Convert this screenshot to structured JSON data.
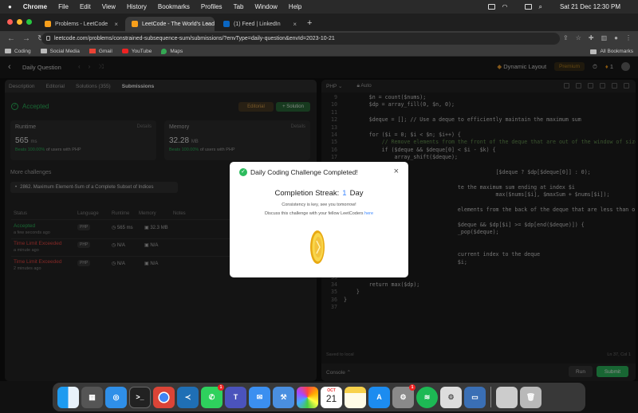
{
  "menubar": {
    "app": "Chrome",
    "items": [
      "File",
      "Edit",
      "View",
      "History",
      "Bookmarks",
      "Profiles",
      "Tab",
      "Window",
      "Help"
    ],
    "datetime": "Sat 21 Dec  12:30 PM"
  },
  "tabs": [
    {
      "title": "Problems - LeetCode",
      "active": false
    },
    {
      "title": "LeetCode - The World's Lead",
      "active": true
    },
    {
      "title": "(1) Feed | LinkedIn",
      "active": false
    }
  ],
  "address": {
    "url": "leetcode.com/problems/constrained-subsequence-sum/submissions/?envType=daily-question&envId=2023-10-21"
  },
  "bookmarks": {
    "items": [
      "Coding",
      "Social Media",
      "Gmail",
      "YouTube",
      "Maps"
    ],
    "all": "All Bookmarks"
  },
  "leetcode": {
    "section": "Daily Question",
    "layout": "Dynamic Layout",
    "premium": "Premium",
    "streak_count": "1"
  },
  "left": {
    "tabs": [
      "Description",
      "Editorial",
      "Solutions (355)",
      "Submissions"
    ],
    "status": "Accepted",
    "editorial_btn": "Editorial",
    "solution_btn": "+ Solution",
    "runtime": {
      "label": "Runtime",
      "details": "Details",
      "value": "565",
      "unit": "ms",
      "beats_pct": "Beats 100.00%",
      "beats_rest": "of users with PHP"
    },
    "memory": {
      "label": "Memory",
      "details": "Details",
      "value": "32.28",
      "unit": "MB",
      "beats_pct": "Beats 100.00%",
      "beats_rest": "of users with PHP"
    },
    "more_challenges": "More challenges",
    "challenge": "2862. Maximum Element-Sum of a Complete Subset of Indices",
    "columns": [
      "Status",
      "Language",
      "Runtime",
      "Memory",
      "Notes"
    ],
    "rows": [
      {
        "status": "Accepted",
        "time": "a few seconds ago",
        "lang": "PHP",
        "runtime": "565 ms",
        "memory": "32.3 MB"
      },
      {
        "status": "Time Limit Exceeded",
        "time": "a minute ago",
        "lang": "PHP",
        "runtime": "N/A",
        "memory": "N/A"
      },
      {
        "status": "Time Limit Exceeded",
        "time": "2 minutes ago",
        "lang": "PHP",
        "runtime": "N/A",
        "memory": "N/A"
      }
    ]
  },
  "editor": {
    "language": "PHP",
    "mode": "Auto",
    "saved": "Saved to local",
    "cursor": "Ln 37, Col 1",
    "console": "Console",
    "run": "Run",
    "submit": "Submit",
    "lines": [
      {
        "n": "9",
        "t": "        $n = count($nums);"
      },
      {
        "n": "10",
        "t": "        $dp = array_fill(0, $n, 0);"
      },
      {
        "n": "11",
        "t": ""
      },
      {
        "n": "12",
        "t": "        $deque = []; // Use a deque to efficiently maintain the maximum sum"
      },
      {
        "n": "13",
        "t": ""
      },
      {
        "n": "14",
        "t": "        for ($i = 0; $i < $n; $i++) {"
      },
      {
        "n": "15",
        "t": "            // Remove elements from the front of the deque that are out of the window of size k"
      },
      {
        "n": "16",
        "t": "            if ($deque && $deque[0] < $i - $k) {"
      },
      {
        "n": "17",
        "t": "                array_shift($deque);"
      },
      {
        "n": "18",
        "t": ""
      },
      {
        "n": "19",
        "t": "                                                [$deque ? $dp[$deque[0]] : 0);"
      },
      {
        "n": "20",
        "t": ""
      },
      {
        "n": "21",
        "t": "                                    te the maximum sum ending at index $i"
      },
      {
        "n": "22",
        "t": "                                                max($nums[$i], $maxSum + $nums[$i]);"
      },
      {
        "n": "23",
        "t": ""
      },
      {
        "n": "24",
        "t": "                                    elements from the back of the deque that are less than or equal to the"
      },
      {
        "n": "25",
        "t": ""
      },
      {
        "n": "26",
        "t": "                                    $deque && $dp[$i] >= $dp[end($deque)]) {"
      },
      {
        "n": "27",
        "t": "                                    _pop($deque);"
      },
      {
        "n": "28",
        "t": ""
      },
      {
        "n": "29",
        "t": ""
      },
      {
        "n": "30",
        "t": "                                    current index to the deque"
      },
      {
        "n": "31",
        "t": "                                    $i;"
      },
      {
        "n": "32",
        "t": ""
      },
      {
        "n": "33",
        "t": ""
      },
      {
        "n": "34",
        "t": "        return max($dp);"
      },
      {
        "n": "35",
        "t": "    }"
      },
      {
        "n": "36",
        "t": "}"
      },
      {
        "n": "37",
        "t": ""
      }
    ]
  },
  "modal": {
    "title": "Daily Coding Challenge Completed!",
    "streak_label": "Completion Streak:",
    "streak_value": "1",
    "streak_unit": "Day",
    "line1": "Consistency is key, see you tomorrow!",
    "line2": "Discuss this challenge with your fellow LeetCoders",
    "link": "here"
  },
  "dock": {
    "apps": [
      "finder-icon",
      "launchpad-icon",
      "safari-icon",
      "terminal-icon",
      "chrome-icon",
      "vscode-icon",
      "whatsapp-icon",
      "teams-icon",
      "mail-icon",
      "xcode-icon",
      "photos-icon",
      "notes-icon",
      "appstore-icon",
      "settings-icon",
      "spotify-icon",
      "system-tool-icon",
      "preview-icon"
    ],
    "calendar_month": "OCT",
    "calendar_day": "21",
    "whatsapp_badge": "1",
    "settings_badge": "1"
  },
  "colors": {
    "accepted": "#2cbb5d",
    "error": "#ef4743",
    "link": "#3a86ff"
  }
}
